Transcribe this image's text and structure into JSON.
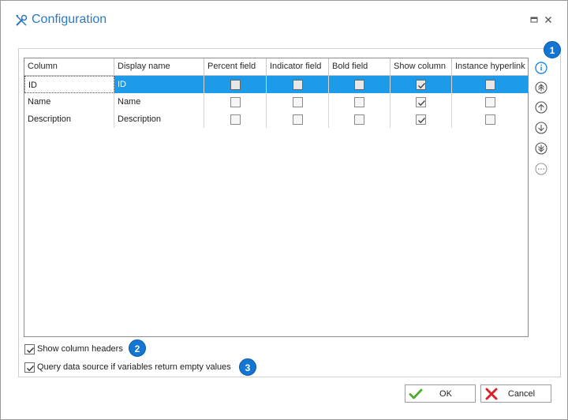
{
  "window": {
    "title": "Configuration",
    "icon": "tools-icon",
    "controls": [
      "maximize-icon",
      "close-icon"
    ]
  },
  "grid": {
    "columns": [
      "Column",
      "Display name",
      "Percent field",
      "Indicator field",
      "Bold field",
      "Show column",
      "Instance hyperlink"
    ],
    "rows": [
      {
        "column": "ID",
        "display_name": "ID",
        "percent": false,
        "indicator": false,
        "bold": false,
        "show": true,
        "hyperlink": false,
        "selected": true
      },
      {
        "column": "Name",
        "display_name": "Name",
        "percent": false,
        "indicator": false,
        "bold": false,
        "show": true,
        "hyperlink": false,
        "selected": false
      },
      {
        "column": "Description",
        "display_name": "Description",
        "percent": false,
        "indicator": false,
        "bold": false,
        "show": true,
        "hyperlink": false,
        "selected": false
      }
    ]
  },
  "side_tools": [
    "info-icon",
    "move-top-icon",
    "move-up-icon",
    "move-down-icon",
    "move-bottom-icon",
    "more-icon"
  ],
  "badges": [
    "1",
    "2",
    "3"
  ],
  "options": {
    "show_headers": {
      "label": "Show column headers",
      "checked": true
    },
    "query_source": {
      "label": "Query data source if variables return empty values",
      "checked": true
    }
  },
  "buttons": {
    "ok": "OK",
    "cancel": "Cancel"
  },
  "colors": {
    "accent": "#2b79c2",
    "selection": "#1e9be8",
    "badge": "#1476d3",
    "ok_icon": "#4caf2a",
    "cancel_icon": "#d6242b"
  }
}
